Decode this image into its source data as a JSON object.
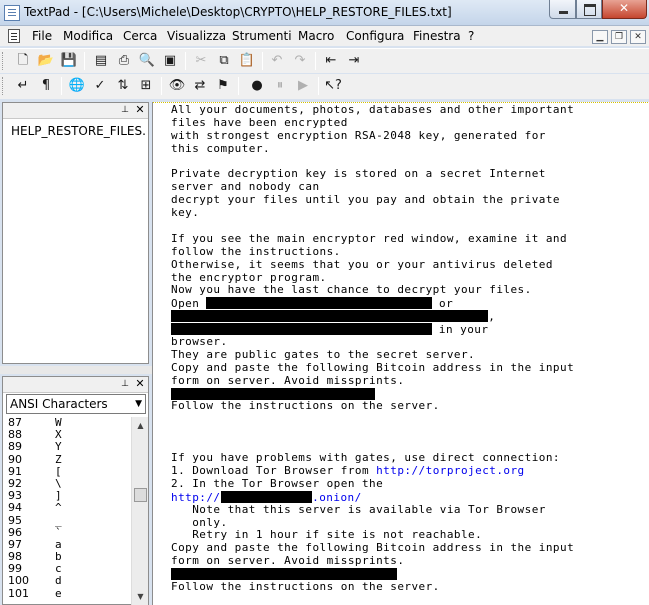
{
  "window": {
    "title": "TextPad - [C:\\Users\\Michele\\Desktop\\CRYPTO\\HELP_RESTORE_FILES.txt]"
  },
  "menu": {
    "items": [
      "File",
      "Modifica",
      "Cerca",
      "Visualizza",
      "Strumenti",
      "Macro",
      "Configura",
      "Finestra",
      "?"
    ]
  },
  "doc_panel": {
    "documents": [
      "HELP_RESTORE_FILES..."
    ]
  },
  "char_panel": {
    "charset": "ANSI Characters",
    "rows": [
      {
        "code": "87",
        "glyph": "W"
      },
      {
        "code": "88",
        "glyph": "X"
      },
      {
        "code": "89",
        "glyph": "Y"
      },
      {
        "code": "90",
        "glyph": "Z"
      },
      {
        "code": "91",
        "glyph": "["
      },
      {
        "code": "92",
        "glyph": "\\"
      },
      {
        "code": "93",
        "glyph": "]"
      },
      {
        "code": "94",
        "glyph": "^"
      },
      {
        "code": "95",
        "glyph": "_"
      },
      {
        "code": "96",
        "glyph": "`"
      },
      {
        "code": "97",
        "glyph": "a"
      },
      {
        "code": "98",
        "glyph": "b"
      },
      {
        "code": "99",
        "glyph": "c"
      },
      {
        "code": "100",
        "glyph": "d"
      },
      {
        "code": "101",
        "glyph": "e"
      }
    ]
  },
  "editor": {
    "lines": [
      {
        "t": "All your documents, photos, databases and other important"
      },
      {
        "t": "files have been encrypted"
      },
      {
        "t": "with strongest encryption RSA-2048 key, generated for"
      },
      {
        "t": "this computer."
      },
      {
        "t": ""
      },
      {
        "t": "Private decryption key is stored on a secret Internet"
      },
      {
        "t": "server and nobody can"
      },
      {
        "t": "decrypt your files until you pay and obtain the private"
      },
      {
        "t": "key."
      },
      {
        "t": ""
      },
      {
        "t": "If you see the main encryptor red window, examine it and"
      },
      {
        "t": "follow the instructions."
      },
      {
        "t": "Otherwise, it seems that you or your antivirus deleted"
      },
      {
        "t": "the encryptor program."
      },
      {
        "t": "Now you have the last chance to decrypt your files."
      },
      {
        "t": "Open ",
        "redact": 32,
        "after": " or"
      },
      {
        "t": "",
        "redact": 45,
        "after": ","
      },
      {
        "t": "",
        "redact": 37,
        "after": " in your"
      },
      {
        "t": "browser."
      },
      {
        "t": "They are public gates to the secret server."
      },
      {
        "t": "Copy and paste the following Bitcoin address in the input"
      },
      {
        "t": "form on server. Avoid missprints."
      },
      {
        "t": "",
        "redact": 29,
        "after": ""
      },
      {
        "t": "Follow the instructions on the server."
      },
      {
        "t": ""
      },
      {
        "t": ""
      },
      {
        "t": ""
      },
      {
        "t": "If you have problems with gates, use direct connection:"
      },
      {
        "t": "1. Download Tor Browser from ",
        "link": "http://torproject.org"
      },
      {
        "t": "2. In the Tor Browser open the"
      },
      {
        "t": "",
        "link": "http://",
        "redact": 13,
        "link_after": ".onion/"
      },
      {
        "t": "   Note that this server is available via Tor Browser"
      },
      {
        "t": "   only."
      },
      {
        "t": "   Retry in 1 hour if site is not reachable."
      },
      {
        "t": "Copy and paste the following Bitcoin address in the input"
      },
      {
        "t": "form on server. Avoid missprints."
      },
      {
        "t": "",
        "redact": 32,
        "after": ""
      },
      {
        "t": "Follow the instructions on the server."
      }
    ]
  },
  "colors": {
    "link": "#0000ee",
    "redaction": "#000000"
  }
}
